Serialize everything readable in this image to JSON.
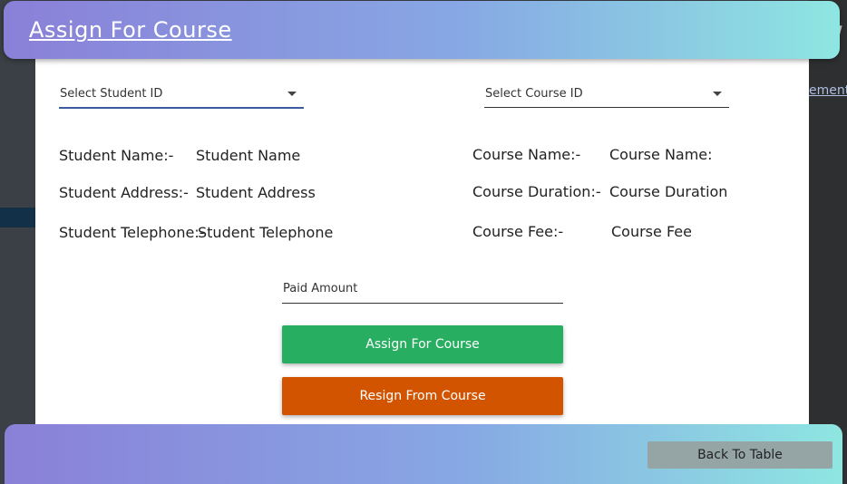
{
  "background": {
    "right_link_text": "ement",
    "right_heading_fragment": "W"
  },
  "header": {
    "title": "Assign For Course"
  },
  "student": {
    "select_placeholder": "Select Student ID",
    "name_label": "Student Name:-",
    "name_value": "Student Name",
    "address_label": "Student Address:-",
    "address_value": "Student Address",
    "telephone_label": "Student Telephone:-",
    "telephone_value": "Student Telephone"
  },
  "course": {
    "select_placeholder": "Select Course ID",
    "name_label": "Course Name:-",
    "name_value": "Course Name:",
    "duration_label": "Course Duration:-",
    "duration_value": "Course Duration",
    "fee_label": "Course Fee:-",
    "fee_value": "Course Fee"
  },
  "payment": {
    "paid_placeholder": "Paid Amount"
  },
  "actions": {
    "assign_label": "Assign For Course",
    "resign_label": "Resign From Course",
    "back_label": "Back To Table"
  },
  "colors": {
    "assign_button": "#27ae60",
    "resign_button": "#d35400",
    "back_button": "#95a5a6",
    "gradient_start": "#8a80d8",
    "gradient_end": "#8ee6e1"
  }
}
